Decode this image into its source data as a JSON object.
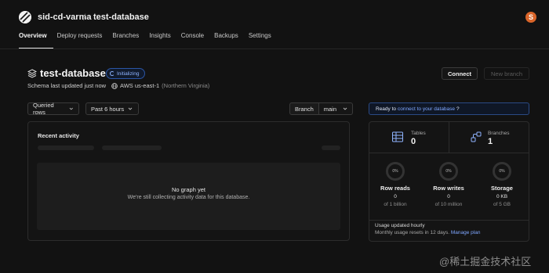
{
  "topbar": {
    "org": "sid-cd-varma",
    "separator": "/",
    "database": "test-database",
    "avatar_letter": "S"
  },
  "tabs": [
    {
      "label": "Overview",
      "active": true
    },
    {
      "label": "Deploy requests"
    },
    {
      "label": "Branches"
    },
    {
      "label": "Insights"
    },
    {
      "label": "Console"
    },
    {
      "label": "Backups"
    },
    {
      "label": "Settings"
    }
  ],
  "header": {
    "title": "test-database",
    "status": "Initializing",
    "schema_note": "Schema last updated just now",
    "region": "AWS us-east-1",
    "region_name": "(Northern Virginia)",
    "connect_label": "Connect",
    "new_branch_label": "New branch"
  },
  "filters": {
    "metric": "Queried rows",
    "range": "Past 6 hours",
    "branch_label": "Branch",
    "branch_value": "main"
  },
  "activity": {
    "title": "Recent activity",
    "empty_title": "No graph yet",
    "empty_subtitle": "We're still collecting activity data for this database."
  },
  "ready": {
    "prefix": "Ready to",
    "link": "connect to your database",
    "suffix": "?"
  },
  "stats": {
    "tables_label": "Tables",
    "tables_value": "0",
    "branches_label": "Branches",
    "branches_value": "1"
  },
  "usage": [
    {
      "ring": "0%",
      "title": "Row reads",
      "value": "0",
      "limit": "of 1 billion",
      "fraction": 0
    },
    {
      "ring": "0%",
      "title": "Row writes",
      "value": "0",
      "limit": "of 10 million",
      "fraction": 0
    },
    {
      "ring": "0%",
      "title": "Storage",
      "value": "0 KB",
      "limit": "of 5 GB",
      "fraction": 0
    }
  ],
  "usage_footer": {
    "note": "Usage updated hourly",
    "reset": "Monthly usage resets in 12 days.",
    "manage_link": "Manage plan"
  },
  "watermark": "@稀土掘金技术社区"
}
